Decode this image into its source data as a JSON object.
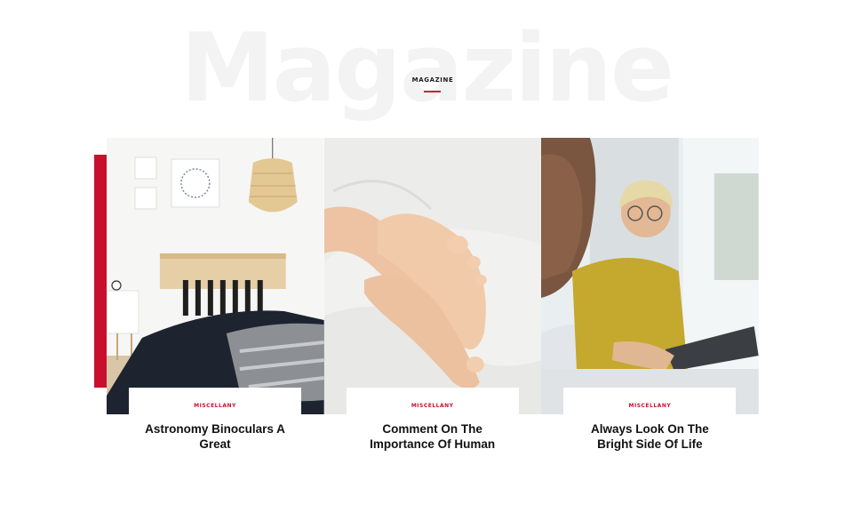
{
  "section": {
    "background_title": "Magazine",
    "label": "MAGAZINE"
  },
  "colors": {
    "accent": "#c8102e",
    "background_title": "#f3f3f3",
    "title_text": "#111111"
  },
  "cards": [
    {
      "category": "MISCELLANY",
      "title": "Astronomy Binoculars A Great"
    },
    {
      "category": "MISCELLANY",
      "title": "Comment On The Importance Of Human"
    },
    {
      "category": "MISCELLANY",
      "title": "Always Look On The Bright Side Of Life"
    }
  ]
}
